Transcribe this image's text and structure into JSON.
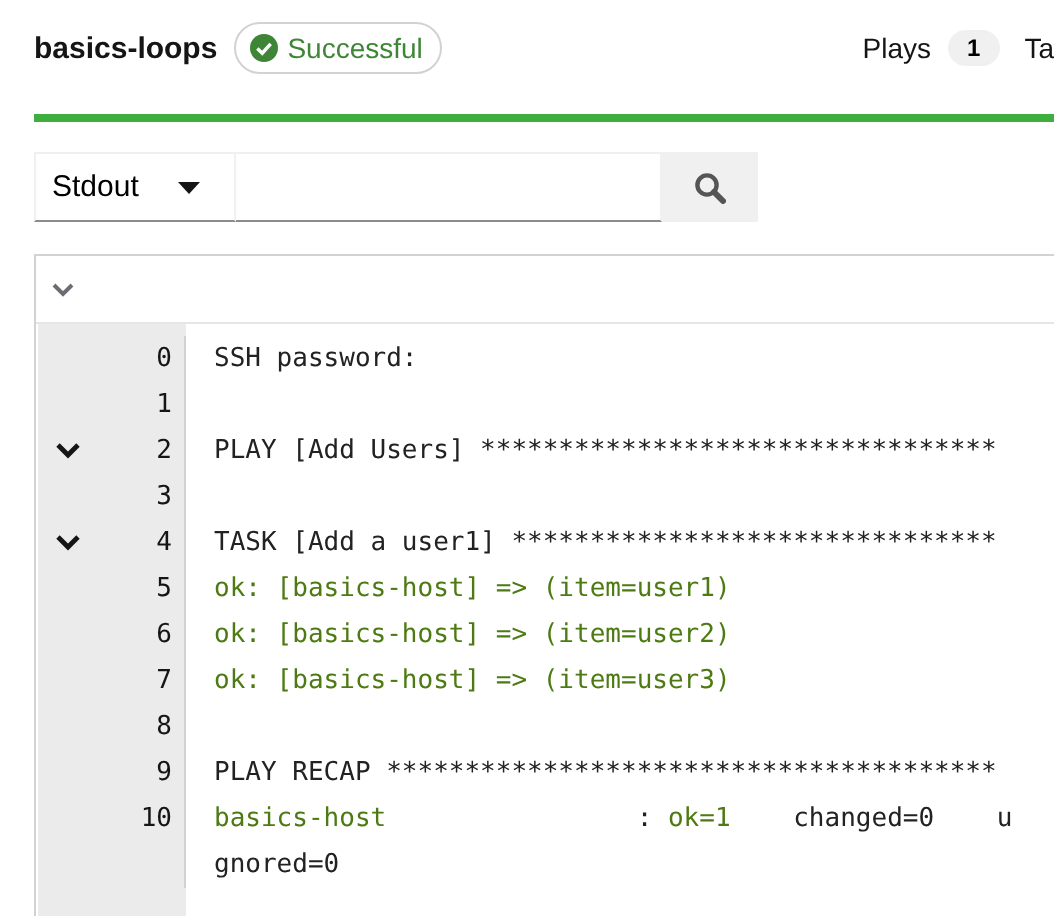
{
  "title": "basics-loops",
  "status": {
    "label": "Successful",
    "kind": "success"
  },
  "stats": [
    {
      "label": "Plays",
      "count": "1"
    },
    {
      "label": "Ta"
    }
  ],
  "progress": {
    "level": 1
  },
  "filter": {
    "value": "Stdout"
  },
  "log": {
    "expanded": true,
    "lines": [
      {
        "number": "0",
        "segments": [
          {
            "text": "SSH password:",
            "kind": "plain"
          }
        ]
      },
      {
        "number": "1"
      },
      {
        "number": "2",
        "expanded": true,
        "segments": [
          {
            "text": "PLAY [Add Users] *********************************",
            "kind": "plain"
          }
        ]
      },
      {
        "number": "3"
      },
      {
        "number": "4",
        "expanded": true,
        "segments": [
          {
            "text": "TASK [Add a user1] *******************************",
            "kind": "plain"
          }
        ]
      },
      {
        "number": "5",
        "segments": [
          {
            "text": "ok: [basics-host] => (item=user1)",
            "kind": "ok"
          }
        ]
      },
      {
        "number": "6",
        "segments": [
          {
            "text": "ok: [basics-host] => (item=user2)",
            "kind": "ok"
          }
        ]
      },
      {
        "number": "7",
        "segments": [
          {
            "text": "ok: [basics-host] => (item=user3)",
            "kind": "ok"
          }
        ]
      },
      {
        "number": "8"
      },
      {
        "number": "9",
        "segments": [
          {
            "text": "PLAY RECAP ***************************************",
            "kind": "plain"
          }
        ]
      },
      {
        "number": "10",
        "segments": [
          {
            "text": "basics-host",
            "kind": "ok"
          },
          {
            "text": "                :",
            "kind": "plain"
          },
          {
            "text": " ok=1",
            "kind": "ok"
          },
          {
            "text": "    changed=0    u",
            "kind": "plain"
          }
        ],
        "continuation": "gnored=0"
      }
    ]
  }
}
